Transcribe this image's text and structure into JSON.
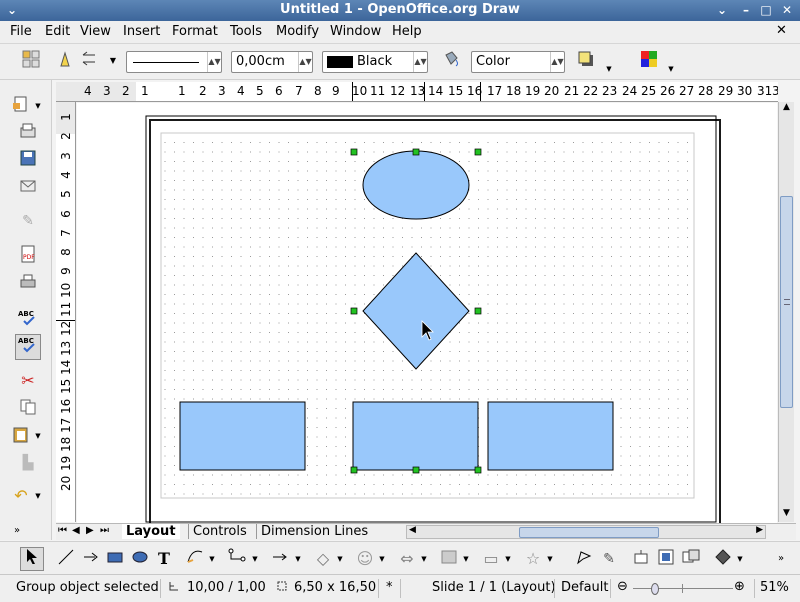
{
  "window": {
    "title": "Untitled 1 - OpenOffice.org Draw"
  },
  "menu": {
    "items": [
      "File",
      "Edit",
      "View",
      "Insert",
      "Format",
      "Tools",
      "Modify",
      "Window",
      "Help"
    ],
    "close_glyph": "✕"
  },
  "toolbar": {
    "line_width": "0,00cm",
    "line_color": "Black",
    "line_color_hex": "#000000",
    "area_style": "Color"
  },
  "rulers": {
    "h_labels": [
      "4",
      "3",
      "2",
      "1",
      "1",
      "2",
      "3",
      "4",
      "5",
      "6",
      "7",
      "8",
      "9",
      "10",
      "11",
      "12",
      "13",
      "14",
      "15",
      "16",
      "17",
      "18",
      "19",
      "20",
      "21",
      "22",
      "23",
      "24",
      "25",
      "26",
      "27",
      "28",
      "29",
      "30",
      "31",
      "3"
    ],
    "v_labels": [
      "1",
      "2",
      "3",
      "4",
      "5",
      "6",
      "7",
      "8",
      "9",
      "10",
      "11",
      "12",
      "13",
      "14",
      "15",
      "16",
      "17",
      "18",
      "19",
      "20"
    ]
  },
  "tabs": [
    "Layout",
    "Controls",
    "Dimension Lines"
  ],
  "status": {
    "selection": "Group object selected",
    "position": "10,00 / 1,00",
    "size": "6,50 x 16,50",
    "modified": "*",
    "slide": "Slide 1 / 1 (Layout)",
    "layout": "Default",
    "zoom": "51%"
  },
  "colors": {
    "shape_fill": "#99c8fb",
    "handle": "#22c222",
    "title_bar": "#4c77a9"
  }
}
